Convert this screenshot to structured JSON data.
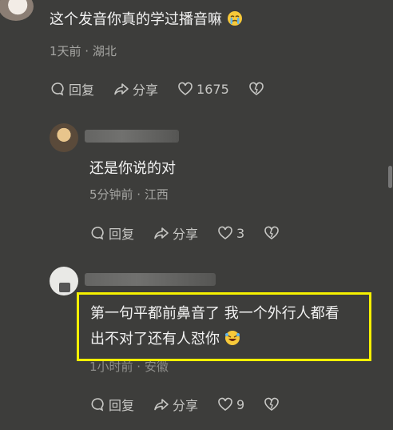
{
  "comments": [
    {
      "text": "这个发音你真的学过播音嘛",
      "emoji": "crying-face-emoji",
      "meta": "1天前 · 湖北",
      "reply": "回复",
      "share": "分享",
      "likes": "1675"
    },
    {
      "text": "还是你说的对",
      "meta": "5分钟前 · 江西",
      "reply": "回复",
      "share": "分享",
      "likes": "3"
    },
    {
      "text_line1": "第一句平都前鼻音了 我一个外行人都看",
      "text_line2": "出不对了还有人怼你",
      "emoji": "rolling-laughing-emoji",
      "meta": "1小时前 · 安徽",
      "reply": "回复",
      "share": "分享",
      "likes": "9"
    }
  ],
  "colors": {
    "background": "#3d3d3b",
    "highlight_border": "#f5f000",
    "meta_text": "#a6a6a3"
  }
}
